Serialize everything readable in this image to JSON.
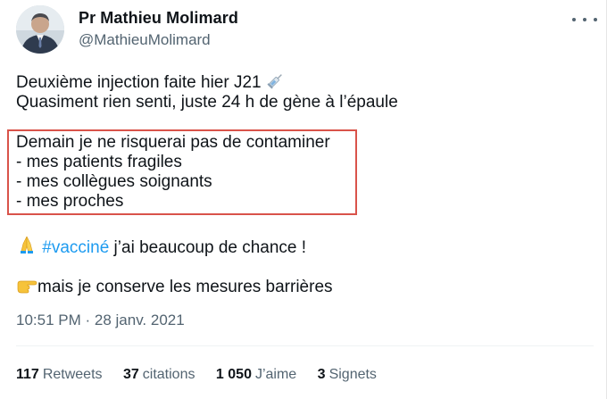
{
  "author": {
    "name": "Pr Mathieu Molimard",
    "handle": "@MathieuMolimard"
  },
  "tweet": {
    "line1": "Deuxième injection faite hier J21",
    "line1_emoji_icon": "syringe-icon",
    "line2": "Quasiment rien senti, juste 24 h de gène à l’épaule",
    "highlighted_lines": [
      "Demain je ne risquerai pas de contaminer",
      "- mes patients fragiles",
      "- mes collègues soignants",
      "- mes proches"
    ],
    "line5_emoji_icon": "folded-hands-icon",
    "hashtag": "#vacciné",
    "line5_rest": " j’ai beaucoup de chance !",
    "line6_emoji_icon": "pointing-hand-icon",
    "line6": "mais je conserve les mesures barrières"
  },
  "meta": {
    "timestamp": "10:51 PM · 28 janv. 2021"
  },
  "stats": {
    "retweets_count": "117",
    "retweets_label": "Retweets",
    "quotes_count": "37",
    "quotes_label": "citations",
    "likes_count": "1 050",
    "likes_label": "J’aime",
    "bookmarks_count": "3",
    "bookmarks_label": "Signets"
  },
  "colors": {
    "link": "#1d9bf0",
    "highlight_border": "#d9534a",
    "secondary_text": "#536471"
  }
}
